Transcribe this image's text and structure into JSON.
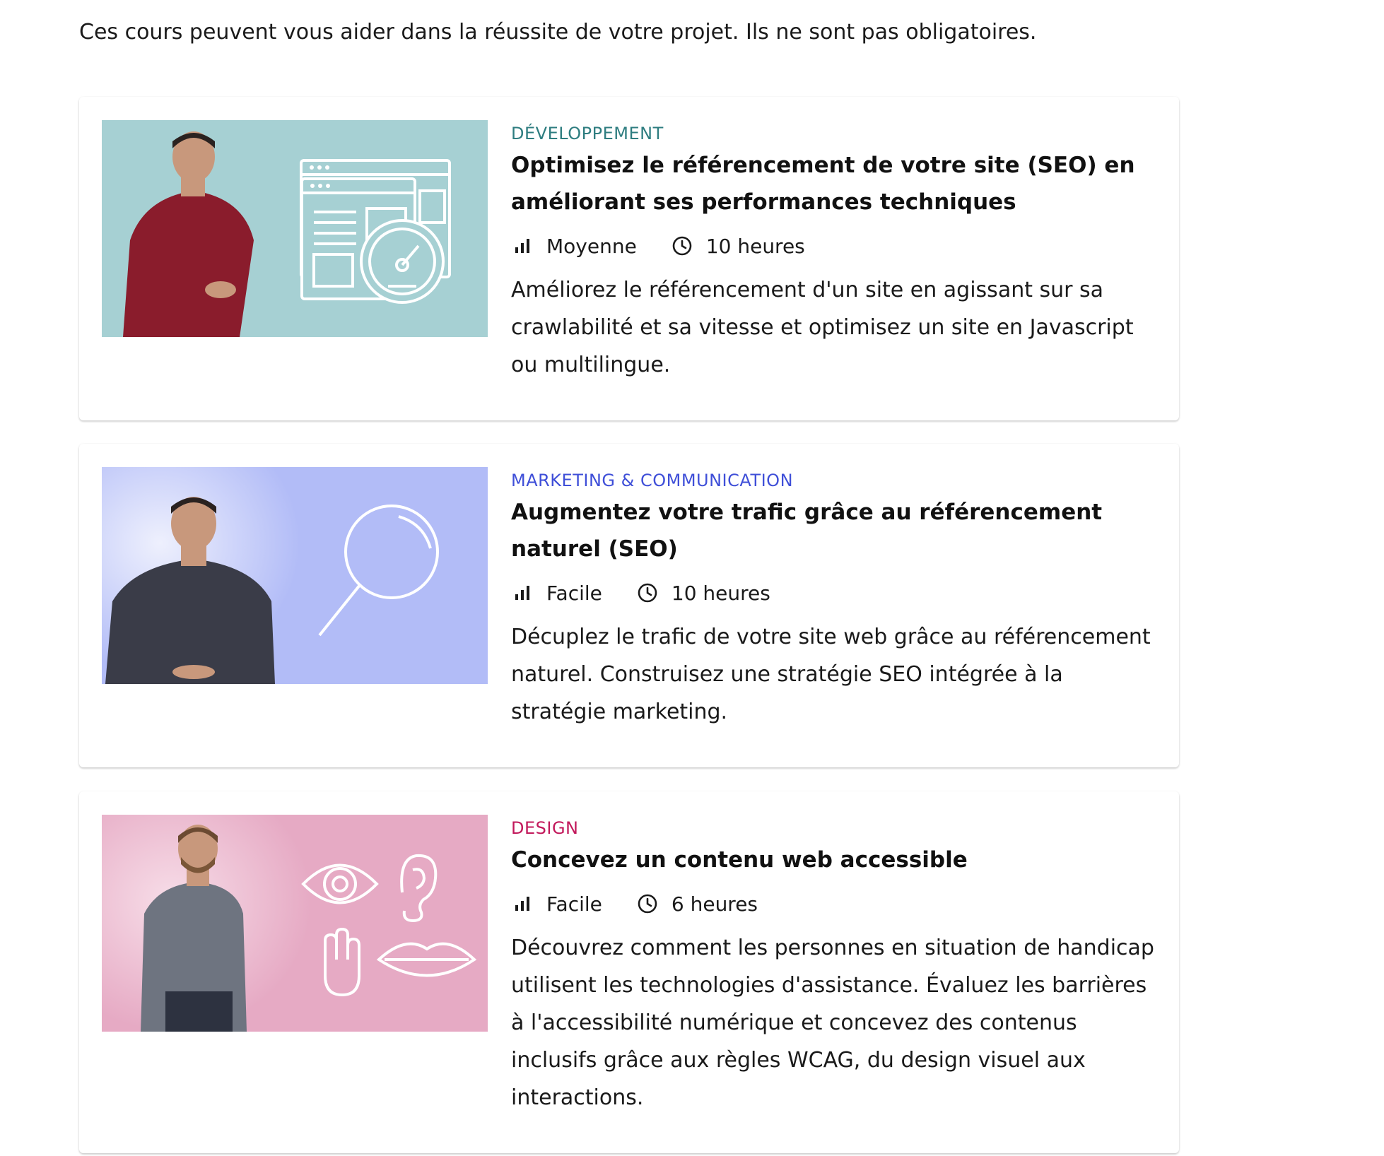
{
  "intro_text": "Ces cours peuvent vous aider dans la réussite de votre projet. Ils ne sont pas obligatoires.",
  "courses": [
    {
      "category": "Développement",
      "category_color": "#2e7d80",
      "thumb_bg": "#a6d0d3",
      "title": "Optimisez le référencement de votre site (SEO) en améliorant ses performances techniques",
      "level": "Moyenne",
      "duration": "10 heures",
      "description": "Améliorez le référencement d'un site en agissant sur sa crawlabilité et sa vitesse et optimisez un site en Javascript ou multilingue."
    },
    {
      "category": "Marketing & Communication",
      "category_color": "#3f4fd8",
      "thumb_bg": "#b2bcf7",
      "title": "Augmentez votre trafic grâce au référencement naturel (SEO)",
      "level": "Facile",
      "duration": "10 heures",
      "description": "Décuplez le trafic de votre site web grâce au référencement naturel. Construisez une stratégie SEO intégrée à la stratégie marketing."
    },
    {
      "category": "Design",
      "category_color": "#c2185b",
      "thumb_bg": "#e6aac4",
      "title": "Concevez un contenu web accessible",
      "level": "Facile",
      "duration": "6 heures",
      "description": "Découvrez comment les personnes en situation de handicap utilisent les technologies d'assistance. Évaluez les barrières à l'accessibilité numérique et concevez des contenus inclusifs grâce aux règles WCAG, du design visuel aux interactions."
    }
  ],
  "icons": {
    "level": "bar-chart-icon",
    "duration": "clock-icon"
  }
}
